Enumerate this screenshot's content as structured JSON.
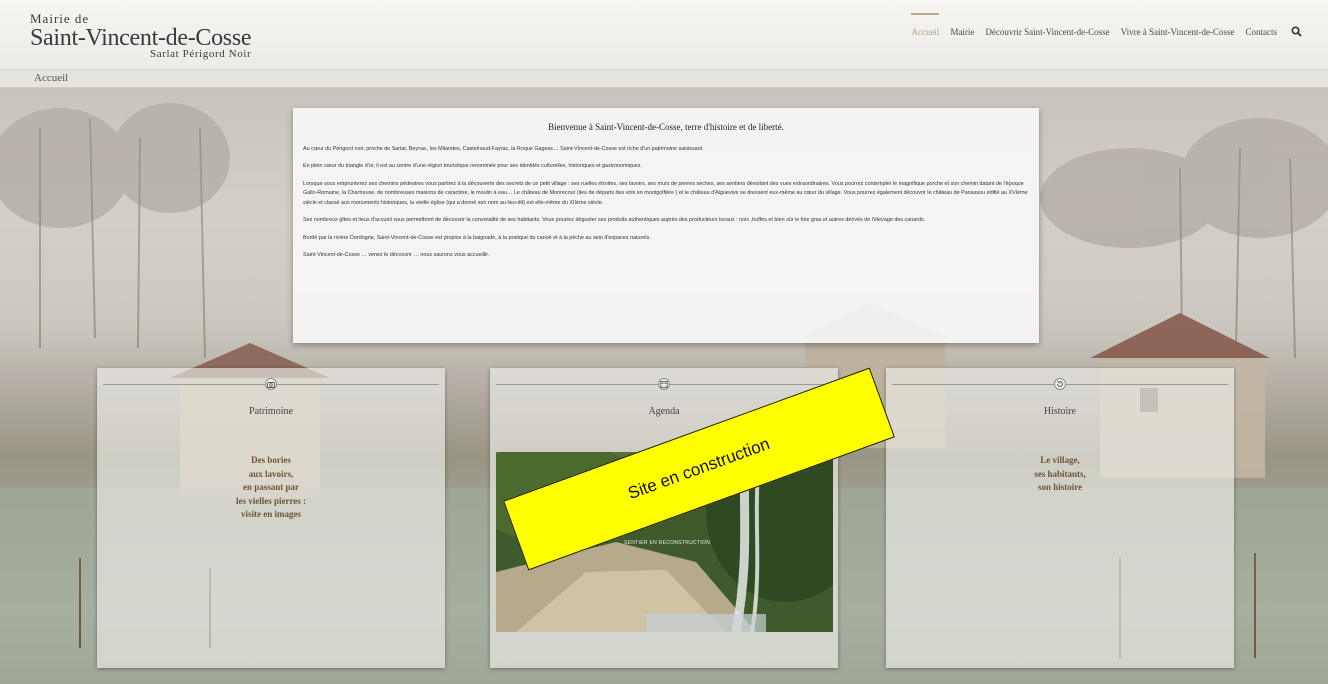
{
  "header": {
    "logo": {
      "line1": "Mairie de",
      "line2": "Saint-Vincent-de-Cosse",
      "line3": "Sarlat Périgord Noir"
    },
    "nav": [
      {
        "label": "Accueil",
        "active": true
      },
      {
        "label": "Mairie"
      },
      {
        "label": "Découvrir Saint-Vincent-de-Cosse"
      },
      {
        "label": "Vivre à Saint-Vincent-de-Cosse"
      },
      {
        "label": "Contacts"
      }
    ],
    "search_icon": "search-icon"
  },
  "breadcrumb": "Accueil",
  "welcome": {
    "title": "Bienvenue à Saint-Vincent-de-Cosse, terre d'histoire et de liberté.",
    "paragraphs": [
      "Au cœur du Périgord noir, proche de Sarlat, Beynac, les Milandes, Castelnaud-Fayrac, la Roque Gageac… Saint-Vincent-de-Cosse est riche d'un patrimoine saisissant.",
      "En plein cœur du triangle d'or, il est au centre d'une région touristique renommée pour ses identités culturelles, historiques et gastronomiques.",
      "Lorsque vous emprunterez ses chemins pédestres vous partirez à la découverte des secrets de ce petit village : ses ruelles étroites, ses lavoirs, ses murs de pierres sèches, ses sentiers dévoilant des vues extraordinaires. Vous pourrez contempler le magnifique porche et son chemin datant de l'époque Gallo-Romaine, la Chartreuse, de nombreuses maisons de caractère, le moulin à eau… Le château de Monrecour (lieu de départs des vols en montgolfière ) et le château d'Aiguevive se dressent eux-même au cœur du village. Vous pourrez également découvrir le château de Panassou édifié au XVIème siècle et classé aux monuments historiques, la vieille église (qui a donné son nom au lieu-dit) est elle-même du XIIème siècle.",
      "Ses nombreux gîtes et lieux d'accueil vous permettront de découvrir la convivialité de ses habitants. Vous pourrez déguster ses produits authentiques auprès des producteurs locaux : noix ,truffes et bien sûr le foie gras et autres dérivés de l'élevage des canards.",
      "Bordé par la rivière Dordogne, Saint-Vincent-de-Cosse est propice à la baignade, à la pratique du canoë et à la pêche au sein d'espaces naturels.",
      "Saint-Vincent-de-Cosse … venez le découvrir … nous saurons vous accueillir."
    ]
  },
  "cards": [
    {
      "title": "Patrimoine",
      "icon": "camera-icon",
      "lines": [
        "Des bories",
        "aux lavoirs,",
        "en passant par",
        "les vielles pierres :",
        "visite en images"
      ]
    },
    {
      "title": "Agenda",
      "icon": "calendar-icon",
      "photo_caption": "SENTIER EN RECONSTRUCTION"
    },
    {
      "title": "Histoire",
      "icon": "history-icon",
      "lines": [
        "Le village,",
        "ses habitants,",
        "son histoire"
      ]
    }
  ],
  "banner": "Site en construction",
  "colors": {
    "accent": "#b0a080",
    "card_text": "#6e5431",
    "banner": "#ffff00"
  }
}
